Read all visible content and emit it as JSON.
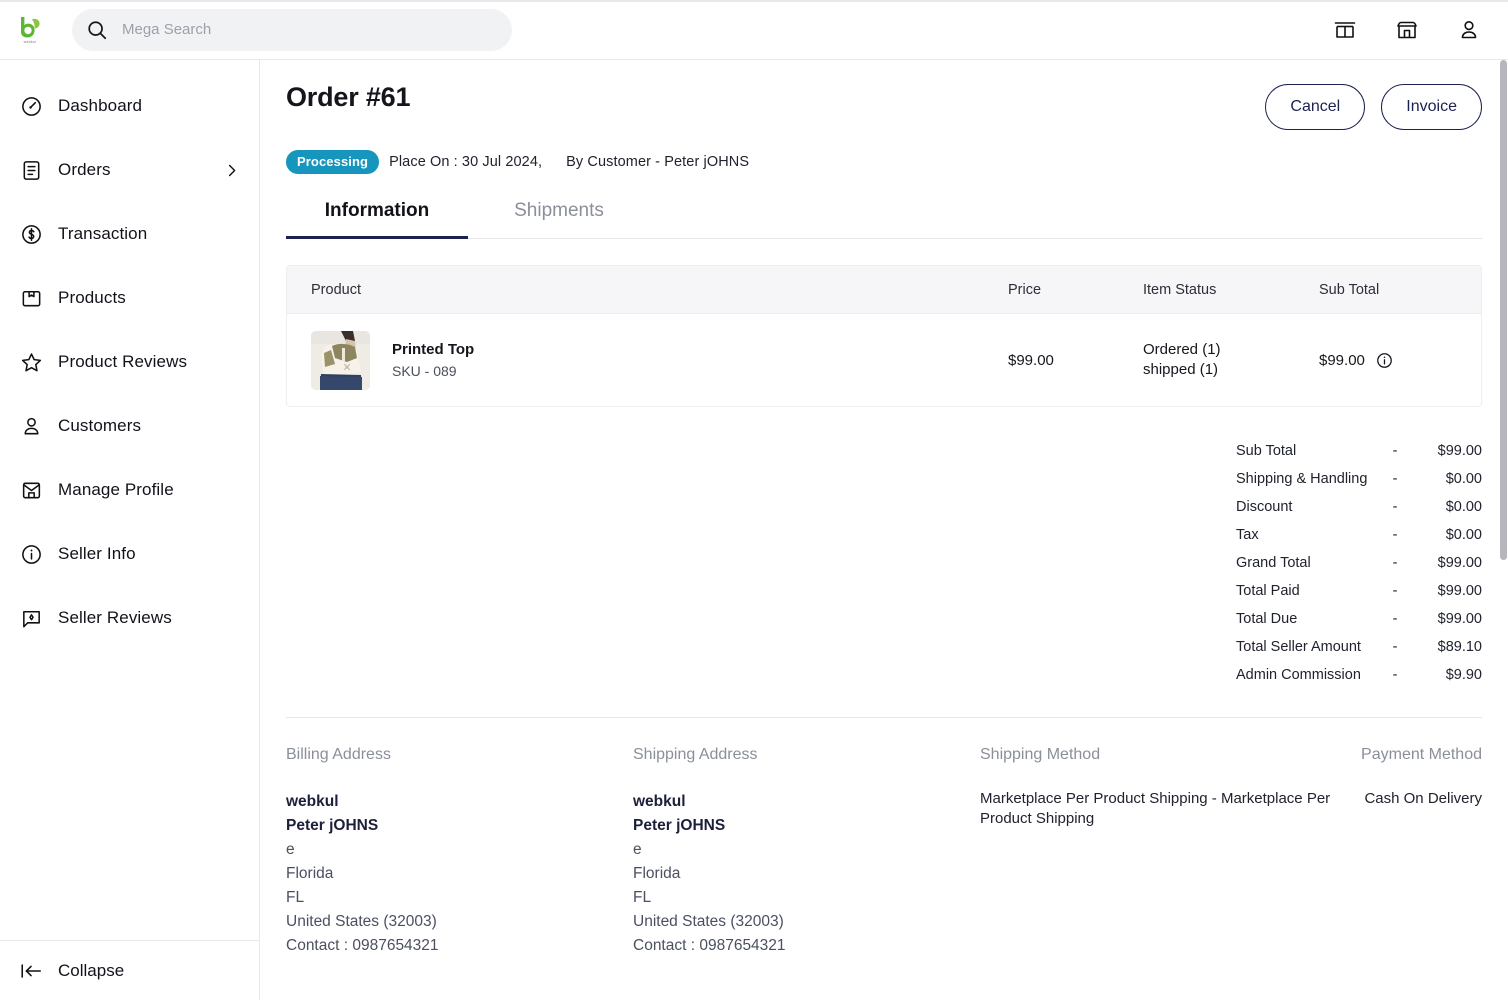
{
  "topbar": {
    "logo_name": "webkul-logo",
    "logo_sub": "webkul",
    "search": {
      "placeholder": "Mega Search",
      "value": ""
    },
    "icons": [
      {
        "name": "store-icon",
        "title": "Store"
      },
      {
        "name": "marketplace-icon",
        "title": "Marketplace"
      },
      {
        "name": "account-icon",
        "title": "Account"
      }
    ]
  },
  "sidebar": {
    "items": [
      {
        "label": "Dashboard",
        "icon": "speedometer-icon",
        "chevron": false
      },
      {
        "label": "Orders",
        "icon": "document-list-icon",
        "chevron": true
      },
      {
        "label": "Transaction",
        "icon": "dollar-circle-icon",
        "chevron": false
      },
      {
        "label": "Products",
        "icon": "product-box-icon",
        "chevron": false
      },
      {
        "label": "Product Reviews",
        "icon": "star-icon",
        "chevron": false
      },
      {
        "label": "Customers",
        "icon": "user-icon",
        "chevron": false
      },
      {
        "label": "Manage Profile",
        "icon": "profile-card-icon",
        "chevron": false
      },
      {
        "label": "Seller Info",
        "icon": "info-circle-icon",
        "chevron": false
      },
      {
        "label": "Seller Reviews",
        "icon": "review-chat-icon",
        "chevron": false
      }
    ],
    "collapse_label": "Collapse"
  },
  "order": {
    "title": "Order #61",
    "status_badge": "Processing",
    "placed_on": "Place On : 30 Jul 2024,",
    "by_customer": "By Customer - Peter jOHNS",
    "actions": {
      "cancel": "Cancel",
      "invoice": "Invoice"
    },
    "tabs": [
      {
        "label": "Information",
        "active": true
      },
      {
        "label": "Shipments",
        "active": false
      }
    ]
  },
  "product_table": {
    "headers": {
      "product": "Product",
      "price": "Price",
      "item_status": "Item Status",
      "sub_total": "Sub Total"
    },
    "rows": [
      {
        "name": "Printed Top",
        "sku": "SKU - 089",
        "price": "$99.00",
        "status_lines": [
          "Ordered (1)",
          "shipped (1)"
        ],
        "sub_total": "$99.00",
        "info_icon": "info-circle-icon"
      }
    ]
  },
  "totals": [
    {
      "label": "Sub Total",
      "dash": "-",
      "value": "$99.00"
    },
    {
      "label": "Shipping & Handling",
      "dash": "-",
      "value": "$0.00"
    },
    {
      "label": "Discount",
      "dash": "-",
      "value": "$0.00"
    },
    {
      "label": "Tax",
      "dash": "-",
      "value": "$0.00"
    },
    {
      "label": "Grand Total",
      "dash": "-",
      "value": "$99.00"
    },
    {
      "label": "Total Paid",
      "dash": "-",
      "value": "$99.00"
    },
    {
      "label": "Total Due",
      "dash": "-",
      "value": "$99.00"
    },
    {
      "label": "Total Seller Amount",
      "dash": "-",
      "value": "$89.10"
    },
    {
      "label": "Admin Commission",
      "dash": "-",
      "value": "$9.90"
    }
  ],
  "billing": {
    "heading": "Billing Address",
    "company": "webkul",
    "name": "Peter jOHNS",
    "lines": [
      "e",
      "Florida",
      "FL",
      "United States (32003)",
      "Contact : 0987654321"
    ]
  },
  "shipping": {
    "heading": "Shipping Address",
    "company": "webkul",
    "name": "Peter jOHNS",
    "lines": [
      "e",
      "Florida",
      "FL",
      "United States (32003)",
      "Contact : 0987654321"
    ]
  },
  "shipping_method": {
    "heading": "Shipping Method",
    "value": "Marketplace Per Product Shipping - Marketplace Per Product Shipping"
  },
  "payment_method": {
    "heading": "Payment Method",
    "value": "Cash On Delivery"
  },
  "colors": {
    "badge_teal": "#1696bd",
    "button_navy": "#1b2250",
    "tab_underline": "#1b2250",
    "muted_text": "#8b8f9a",
    "table_head_bg": "#f6f6f8",
    "search_bg": "#f1f2f4",
    "logo_green": "#5cb631"
  }
}
